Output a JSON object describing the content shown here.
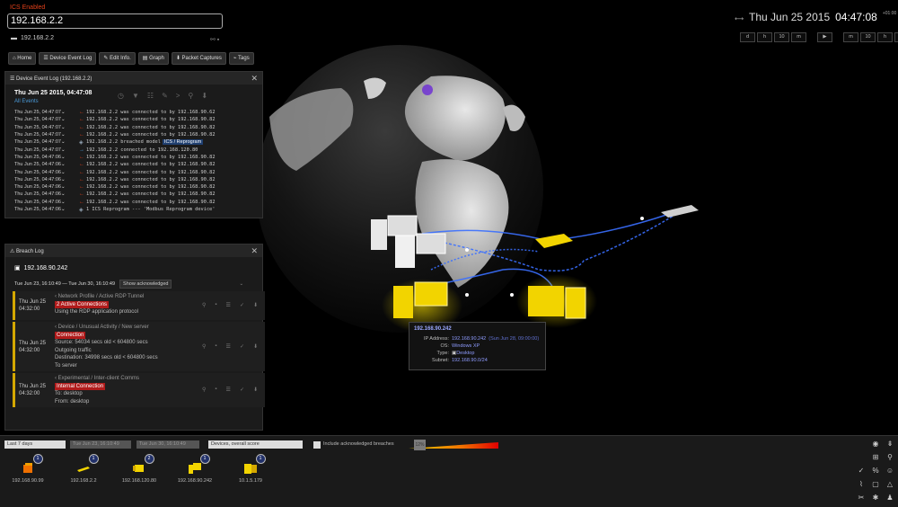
{
  "ics_label": "ICS Enabled",
  "search": {
    "value": "192.168.2.2"
  },
  "device_ip": "192.168.2.2",
  "nav": [
    "Home",
    "Device Event Log",
    "Edit Info.",
    "Graph",
    "Packet Captures",
    "Tags"
  ],
  "event_log": {
    "title": "Device Event Log (192.168.2.2)",
    "date": "Thu Jun 25 2015, 04:47:08",
    "filter": "All Events",
    "rows": [
      {
        "time": "Thu Jun 25, 04:47:07",
        "text": "192.168.2.2 was connected to by 192.168.90.62",
        "tag": ""
      },
      {
        "time": "Thu Jun 25, 04:47:07",
        "text": "192.168.2.2 was connected to by 192.168.90.82",
        "tag": ""
      },
      {
        "time": "Thu Jun 25, 04:47:07",
        "text": "192.168.2.2 was connected to by 192.168.90.82",
        "tag": ""
      },
      {
        "time": "Thu Jun 25, 04:47:07",
        "text": "192.168.2.2 was connected to by 192.168.90.82",
        "tag": ""
      },
      {
        "time": "Thu Jun 25, 04:47:07",
        "text": "192.168.2.2 breached model",
        "tag": "ICS / Reprogram"
      },
      {
        "time": "Thu Jun 25, 04:47:07",
        "text": "192.168.2.2 connected to 192.168.120.80",
        "tag": ""
      },
      {
        "time": "Thu Jun 25, 04:47:06",
        "text": "192.168.2.2 was connected to by 192.168.90.82",
        "tag": ""
      },
      {
        "time": "Thu Jun 25, 04:47:06",
        "text": "192.168.2.2 was connected to by 192.168.90.82",
        "tag": ""
      },
      {
        "time": "Thu Jun 25, 04:47:06",
        "text": "192.168.2.2 was connected to by 192.168.90.82",
        "tag": ""
      },
      {
        "time": "Thu Jun 25, 04:47:06",
        "text": "192.168.2.2 was connected to by 192.168.90.82",
        "tag": ""
      },
      {
        "time": "Thu Jun 25, 04:47:06",
        "text": "192.168.2.2 was connected to by 192.168.90.82",
        "tag": ""
      },
      {
        "time": "Thu Jun 25, 04:47:06",
        "text": "192.168.2.2 was connected to by 192.168.90.82",
        "tag": ""
      },
      {
        "time": "Thu Jun 25, 04:47:06",
        "text": "192.168.2.2 was connected to by 192.168.90.82",
        "tag": ""
      },
      {
        "time": "Thu Jun 25, 04:47:06",
        "text": "1 ICS Reprogram --- 'Modbus Reprogram device'",
        "tag": ""
      }
    ]
  },
  "breach_log": {
    "title": "Breach Log",
    "device": "192.168.90.242",
    "range": "Tue Jun 23, 16:10:49 — Tue Jun 30, 16:10:49",
    "show_ack": "Show acknowledged",
    "items": [
      {
        "date": "Thu Jun 25",
        "time": "04:32:00",
        "model": "Network Profile / Active RDP Tunnel",
        "badge": "2 Active Connections",
        "lines": [
          "Using the RDP application protocol"
        ]
      },
      {
        "date": "Thu Jun 25",
        "time": "04:32:00",
        "model": "Device / Unusual Activity / New server",
        "badge": "Connection",
        "lines": [
          "Source: 54034 secs old < 604800 secs",
          "Outgoing traffic",
          "Destination: 34998 secs old < 604800 secs",
          "To server"
        ]
      },
      {
        "date": "Thu Jun 25",
        "time": "04:32:00",
        "model": "Experimental / Inter-client Comms",
        "badge": "Internal Connection",
        "lines": [
          "To: desktop",
          "From: desktop"
        ]
      }
    ]
  },
  "clock": {
    "date": "Thu Jun 25 2015",
    "time": "04:47:08",
    "tz": "+01:00"
  },
  "timeline_buttons": [
    "d",
    "h",
    "10",
    "m",
    "▶",
    "m",
    "10",
    "h",
    "d",
    "▶▶"
  ],
  "tooltip": {
    "title": "192.168.90.242",
    "ip_label": "IP Address:",
    "ip": "192.168.90.242",
    "ip_note": "(Sun Jun 28, 09:00:00)",
    "os_label": "OS:",
    "os": "Windows XP",
    "type_label": "Type:",
    "type": "Desktop",
    "subnet_label": "Subnet:",
    "subnet": "192.168.90.0/24"
  },
  "bottom": {
    "period": "Last 7 days",
    "from": "Tue Jun 23, 16:10:49",
    "to": "Tue Jun 30, 16:10:49",
    "sort": "Devices, overall score",
    "include_label": "Include acknowledged breaches",
    "slider_value": "12%",
    "devices": [
      {
        "count": "1",
        "label": "192.168.90.99"
      },
      {
        "count": "1",
        "label": "192.168.2.2"
      },
      {
        "count": "2",
        "label": "192.168.120.80"
      },
      {
        "count": "1",
        "label": "192.168.90.242"
      },
      {
        "count": "1",
        "label": "10.1.5.179"
      }
    ]
  },
  "colors": {
    "accent_yellow": "#f2d400",
    "badge_red": "#b01b1b",
    "link_blue": "#8f9cff"
  }
}
